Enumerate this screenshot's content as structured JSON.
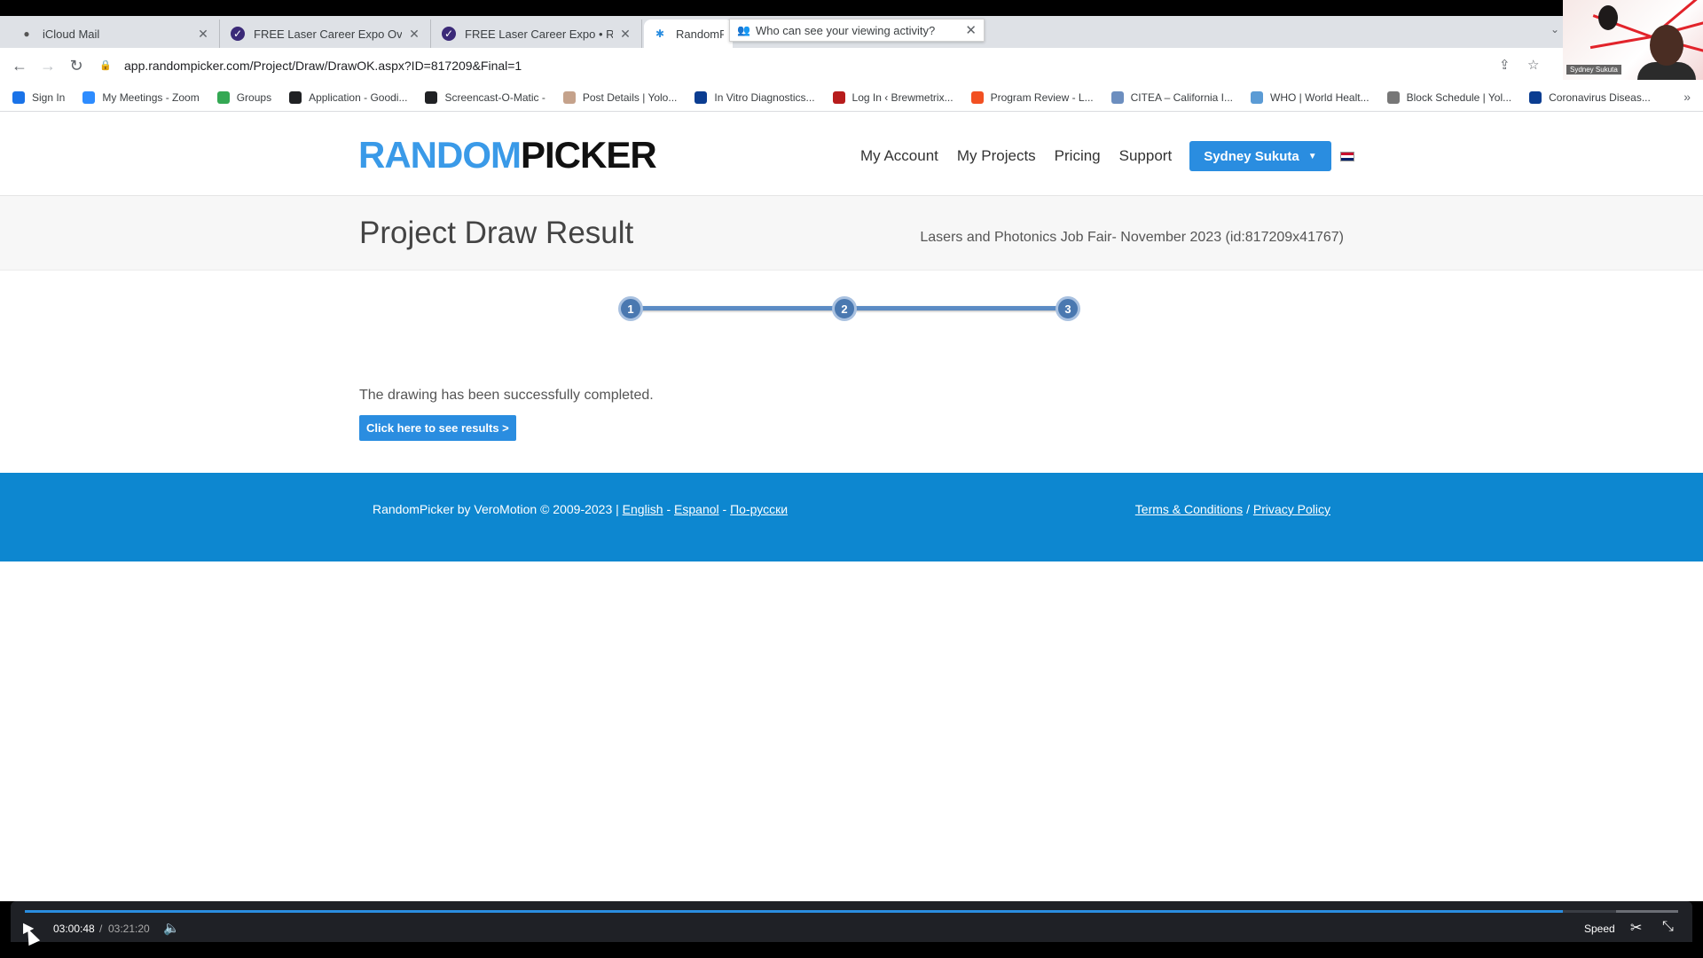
{
  "browser": {
    "tabs": [
      {
        "title": "iCloud Mail",
        "icon": "apple-icon"
      },
      {
        "title": "FREE Laser Career Expo Overvie",
        "icon": "check-circle-icon"
      },
      {
        "title": "FREE Laser Career Expo • RSVP",
        "icon": "check-circle-icon"
      },
      {
        "title": "RandomP",
        "icon": "asterisk-icon",
        "active": true
      }
    ],
    "tooltip": "Who can see your viewing activity?",
    "url": "app.randompicker.com/Project/Draw/DrawOK.aspx?ID=817209&Final=1",
    "bookmarks": [
      {
        "label": "Sign In",
        "icon_color": "#1a73e8"
      },
      {
        "label": "My Meetings - Zoom",
        "icon_color": "#2d8cff"
      },
      {
        "label": "Groups",
        "icon_color": "#34a853"
      },
      {
        "label": "Application - Goodi...",
        "icon_color": "#202124"
      },
      {
        "label": "Screencast-O-Matic -",
        "icon_color": "#202124"
      },
      {
        "label": "Post Details | Yolo...",
        "icon_color": "#c5a28b"
      },
      {
        "label": "In Vitro Diagnostics...",
        "icon_color": "#0b3d91"
      },
      {
        "label": "Log In ‹ Brewmetrix...",
        "icon_color": "#b71c1c"
      },
      {
        "label": "Program Review - L...",
        "icon_color": "#f25022"
      },
      {
        "label": "CITEA – California I...",
        "icon_color": "#6c8ebf"
      },
      {
        "label": "WHO | World Healt...",
        "icon_color": "#5b9bd5"
      },
      {
        "label": "Block Schedule | Yol...",
        "icon_color": "#777777"
      },
      {
        "label": "Coronavirus Diseas...",
        "icon_color": "#0b3d91"
      }
    ],
    "bookmarks_overflow": "»"
  },
  "webcam": {
    "label": "Sydney Sukuta"
  },
  "site": {
    "logo_part1": "RANDOM",
    "logo_part2": "PICKER",
    "nav": [
      "My Account",
      "My Projects",
      "Pricing",
      "Support"
    ],
    "user_button": "Sydney Sukuta",
    "page_title": "Project Draw Result",
    "project_name": "Lasers and Photonics Job Fair- November 2023 (id:817209x41767)",
    "steps": [
      "1",
      "2",
      "3"
    ],
    "message": "The drawing has been successfully completed.",
    "results_button": "Click here to see results >",
    "footer": {
      "copyright": "RandomPicker by VeroMotion © 2009-2023 |",
      "lang_english": "English",
      "lang_espanol": "Espanol",
      "lang_russian": "По-русски",
      "terms": "Terms & Conditions",
      "slash": "/",
      "privacy": "Privacy Policy"
    }
  },
  "player": {
    "current_time": "03:00:48",
    "separator": "/",
    "total_time": "03:21:20",
    "progress_fraction": 0.93,
    "speed_label": "Speed"
  },
  "colors": {
    "accent": "#2a8de0",
    "footer": "#0d87d0",
    "logo_blue": "#3a9ae8"
  }
}
